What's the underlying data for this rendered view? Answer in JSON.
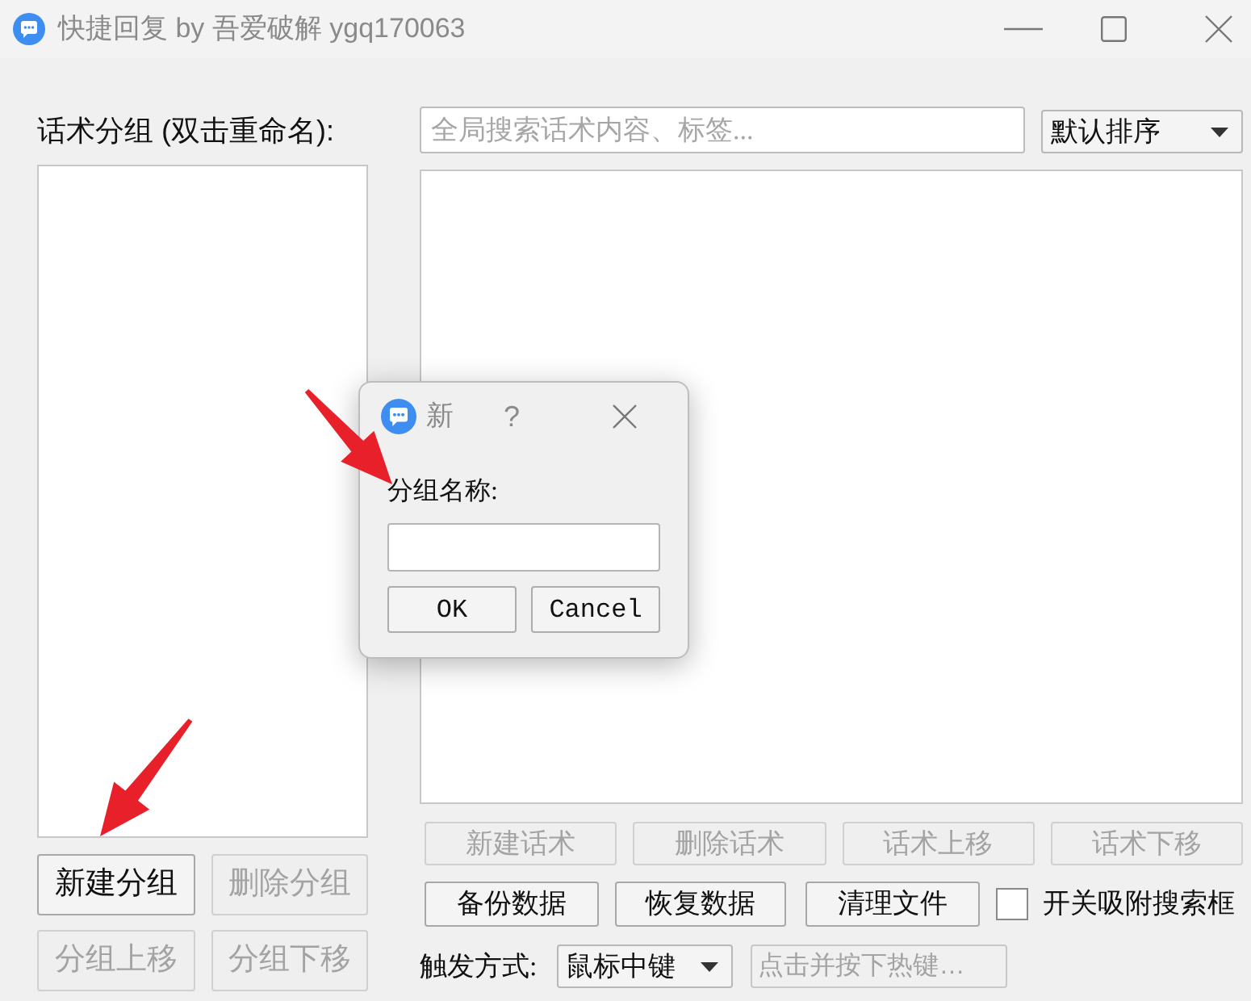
{
  "window": {
    "title": "快捷回复 by 吾爱破解 ygq170063"
  },
  "groups_panel": {
    "label": "话术分组 (双击重命名):",
    "buttons": [
      {
        "label": "新建分组",
        "disabled": false
      },
      {
        "label": "删除分组",
        "disabled": true
      },
      {
        "label": "分组上移",
        "disabled": true
      },
      {
        "label": "分组下移",
        "disabled": true
      }
    ]
  },
  "search": {
    "placeholder": "全局搜索话术内容、标签..."
  },
  "sort_dropdown": {
    "value": "默认排序"
  },
  "phrase_buttons": [
    {
      "label": "新建话术",
      "disabled": true
    },
    {
      "label": "删除话术",
      "disabled": true
    },
    {
      "label": "话术上移",
      "disabled": true
    },
    {
      "label": "话术下移",
      "disabled": true
    }
  ],
  "data_buttons": [
    {
      "label": "备份数据",
      "disabled": false
    },
    {
      "label": "恢复数据",
      "disabled": false
    },
    {
      "label": "清理文件",
      "disabled": false
    }
  ],
  "snap_checkbox": {
    "label": "开关吸附搜索框",
    "checked": false
  },
  "trigger": {
    "label": "触发方式:",
    "value": "鼠标中键",
    "hotkey_placeholder": "点击并按下热键…"
  },
  "dialog": {
    "title": "新",
    "help": "?",
    "label": "分组名称:",
    "buttons": [
      "OK",
      "Cancel"
    ]
  }
}
